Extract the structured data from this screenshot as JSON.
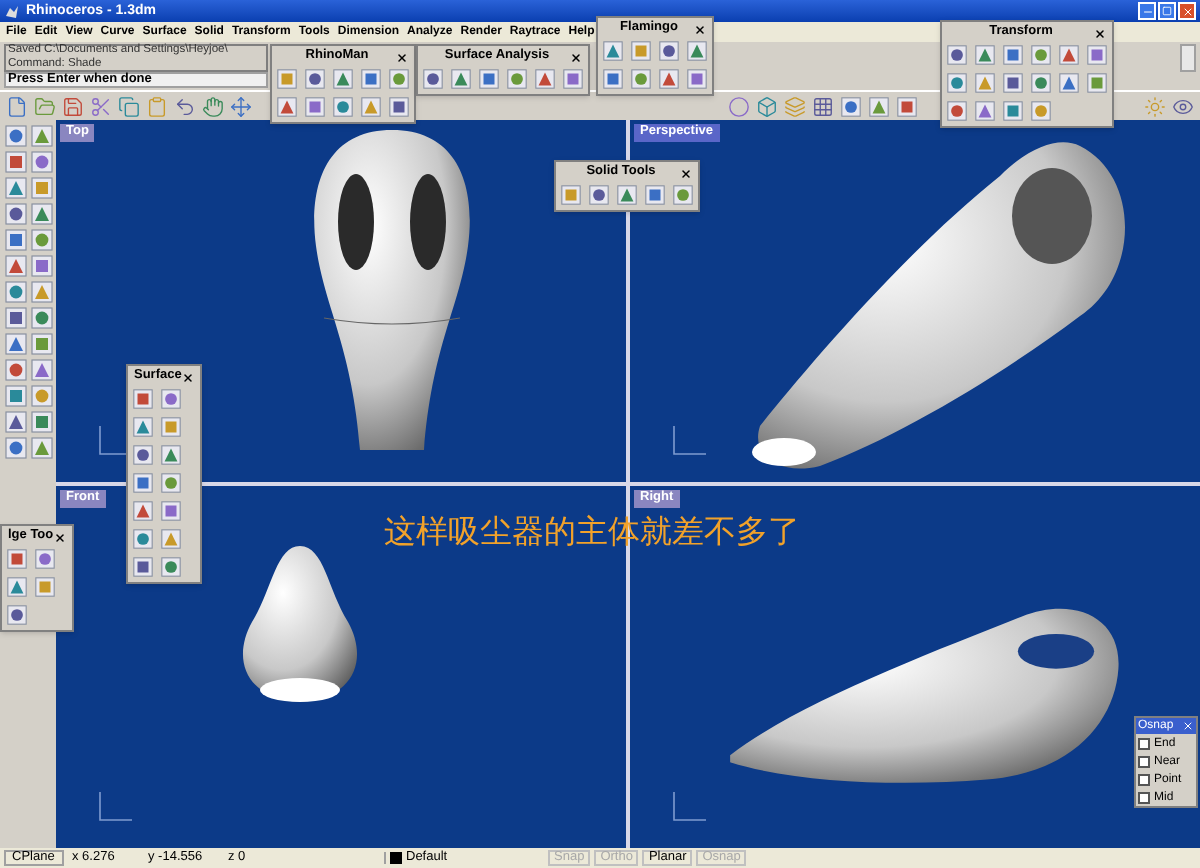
{
  "window": {
    "title": "Rhinoceros - 1.3dm"
  },
  "menu": [
    "File",
    "Edit",
    "View",
    "Curve",
    "Surface",
    "Solid",
    "Transform",
    "Tools",
    "Dimension",
    "Analyze",
    "Render",
    "Raytrace",
    "Help"
  ],
  "command_history": [
    "Saved C:\\Documents and Settings\\Heyjoe\\",
    "Command: Shade"
  ],
  "command_prompt": "Press Enter when done",
  "viewports": [
    {
      "label": "Top",
      "selected": false
    },
    {
      "label": "Perspective",
      "selected": true
    },
    {
      "label": "Front",
      "selected": false
    },
    {
      "label": "Right",
      "selected": false
    }
  ],
  "caption": "这样吸尘器的主体就差不多了",
  "palettes": [
    {
      "title": "RhinoMan"
    },
    {
      "title": "Surface Analysis"
    },
    {
      "title": "Flamingo"
    },
    {
      "title": "Transform"
    },
    {
      "title": "Solid Tools"
    },
    {
      "title": "Surface"
    },
    {
      "title": "lge Too"
    }
  ],
  "osnap": {
    "title": "Osnap",
    "items": [
      {
        "label": "End",
        "checked": false
      },
      {
        "label": "Near",
        "checked": false
      },
      {
        "label": "Point",
        "checked": false
      },
      {
        "label": "Mid",
        "checked": false
      }
    ]
  },
  "status_bar": {
    "cplane": "CPlane",
    "x": "x 6.276",
    "y": "y -14.556",
    "z": "z 0",
    "layer": "Default",
    "panes": [
      {
        "label": "Snap",
        "on": false
      },
      {
        "label": "Ortho",
        "on": false
      },
      {
        "label": "Planar",
        "on": true
      },
      {
        "label": "Osnap",
        "on": false
      }
    ]
  }
}
